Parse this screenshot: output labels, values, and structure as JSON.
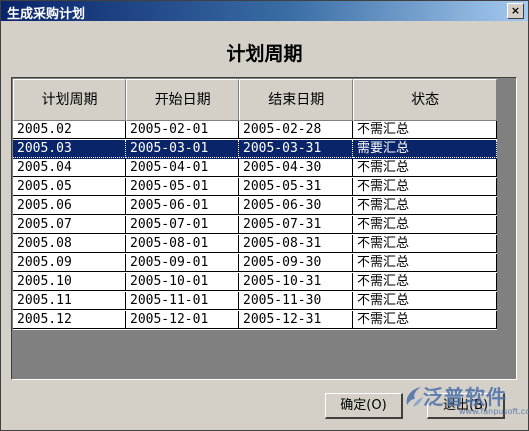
{
  "window": {
    "title": "生成采购计划",
    "close_label": "×"
  },
  "heading": "计划周期",
  "table": {
    "columns": [
      "计划周期",
      "开始日期",
      "结束日期",
      "状态"
    ],
    "rows": [
      {
        "period": "2005.02",
        "start": "2005-02-01",
        "end": "2005-02-28",
        "status": "不需汇总"
      },
      {
        "period": "2005.03",
        "start": "2005-03-01",
        "end": "2005-03-31",
        "status": "需要汇总",
        "selected": true
      },
      {
        "period": "2005.04",
        "start": "2005-04-01",
        "end": "2005-04-30",
        "status": "不需汇总"
      },
      {
        "period": "2005.05",
        "start": "2005-05-01",
        "end": "2005-05-31",
        "status": "不需汇总"
      },
      {
        "period": "2005.06",
        "start": "2005-06-01",
        "end": "2005-06-30",
        "status": "不需汇总"
      },
      {
        "period": "2005.07",
        "start": "2005-07-01",
        "end": "2005-07-31",
        "status": "不需汇总"
      },
      {
        "period": "2005.08",
        "start": "2005-08-01",
        "end": "2005-08-31",
        "status": "不需汇总"
      },
      {
        "period": "2005.09",
        "start": "2005-09-01",
        "end": "2005-09-30",
        "status": "不需汇总"
      },
      {
        "period": "2005.10",
        "start": "2005-10-01",
        "end": "2005-10-31",
        "status": "不需汇总"
      },
      {
        "period": "2005.11",
        "start": "2005-11-01",
        "end": "2005-11-30",
        "status": "不需汇总"
      },
      {
        "period": "2005.12",
        "start": "2005-12-01",
        "end": "2005-12-31",
        "status": "不需汇总"
      }
    ]
  },
  "buttons": {
    "ok": "确定(O)",
    "back": "退出(B)"
  },
  "watermark": {
    "text": "泛普软件",
    "url": "www.fanpusoft.com",
    "icon": "swirl-logo-icon"
  },
  "colors": {
    "title_bar": "#0a246a",
    "selection": "#0a246a",
    "dialog_bg": "#d4d0c8"
  }
}
